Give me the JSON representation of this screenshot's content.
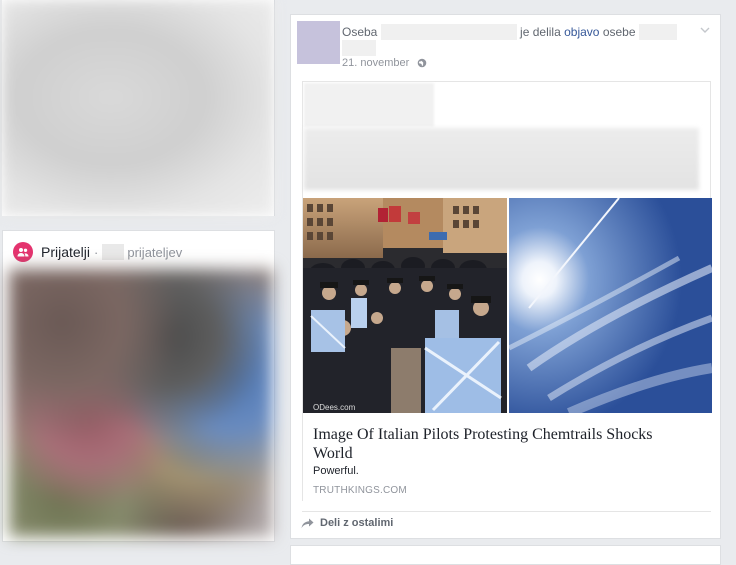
{
  "post": {
    "prefix": "Oseba",
    "shared_text": "je delila",
    "shared_link": "objavo",
    "owner_text": "osebe",
    "date": "21. november",
    "share_label": "Deli z ostalimi"
  },
  "link": {
    "title": "Image Of Italian Pilots Protesting Chemtrails Shocks World",
    "description": "Powerful.",
    "domain": "TRUTHKINGS.COM",
    "watermark": "ODees.com"
  },
  "friends": {
    "title": "Prijatelji",
    "separator": "·",
    "subtitle": "prijateljev"
  },
  "colors": {
    "friends_icon": "#e4336e",
    "link_blue": "#365899",
    "muted": "#90949c"
  }
}
